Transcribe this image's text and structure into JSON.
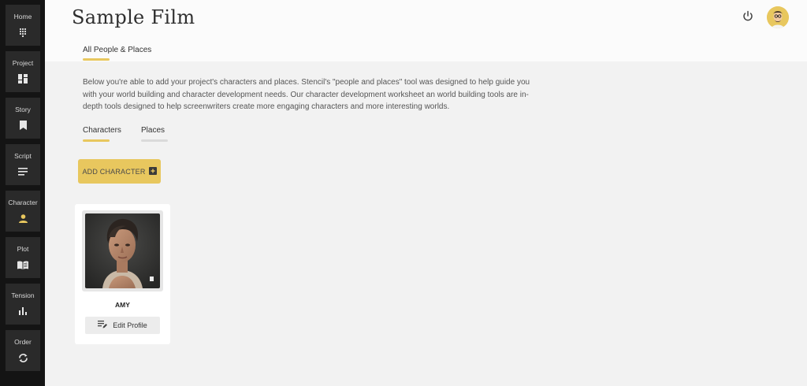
{
  "sidebar": {
    "items": [
      {
        "label": "Home",
        "icon": "dots-grid-icon",
        "icon_color": "#e6e6e6"
      },
      {
        "label": "Project",
        "icon": "dashboard-icon",
        "icon_color": "#e6e6e6"
      },
      {
        "label": "Story",
        "icon": "bookmark-icon",
        "icon_color": "#e6e6e6"
      },
      {
        "label": "Script",
        "icon": "lines-icon",
        "icon_color": "#e6e6e6"
      },
      {
        "label": "Character",
        "icon": "person-icon",
        "icon_color": "#e8c75e"
      },
      {
        "label": "Plot",
        "icon": "book-icon",
        "icon_color": "#e6e6e6"
      },
      {
        "label": "Tension",
        "icon": "bar-chart-icon",
        "icon_color": "#e6e6e6"
      },
      {
        "label": "Order",
        "icon": "refresh-icon",
        "icon_color": "#e6e6e6"
      }
    ]
  },
  "header": {
    "title": "Sample Film",
    "power_icon": "power-icon",
    "avatar_icon": "user-avatar"
  },
  "tabs": {
    "main": "All People & Places"
  },
  "intro": "Below you're able to add your project's characters and places. Stencil's \"people and places\" tool was designed to help guide you with your world building and character development needs. Our character development worksheet an world building tools are in-depth tools designed to help screenwriters create more engaging characters and more interesting worlds.",
  "subtabs": {
    "characters": "Characters",
    "places": "Places",
    "active": "characters"
  },
  "add_button": {
    "label": "ADD CHARACTER",
    "icon": "add-box-icon"
  },
  "characters": [
    {
      "name": "AMY",
      "edit_label": "Edit Profile",
      "edit_icon": "edit-list-icon"
    }
  ],
  "colors": {
    "accent": "#e8c75e",
    "sidebar_bg": "#141414",
    "sidebar_item_bg": "#2a2a2a",
    "content_bg": "#f2f2f2"
  }
}
